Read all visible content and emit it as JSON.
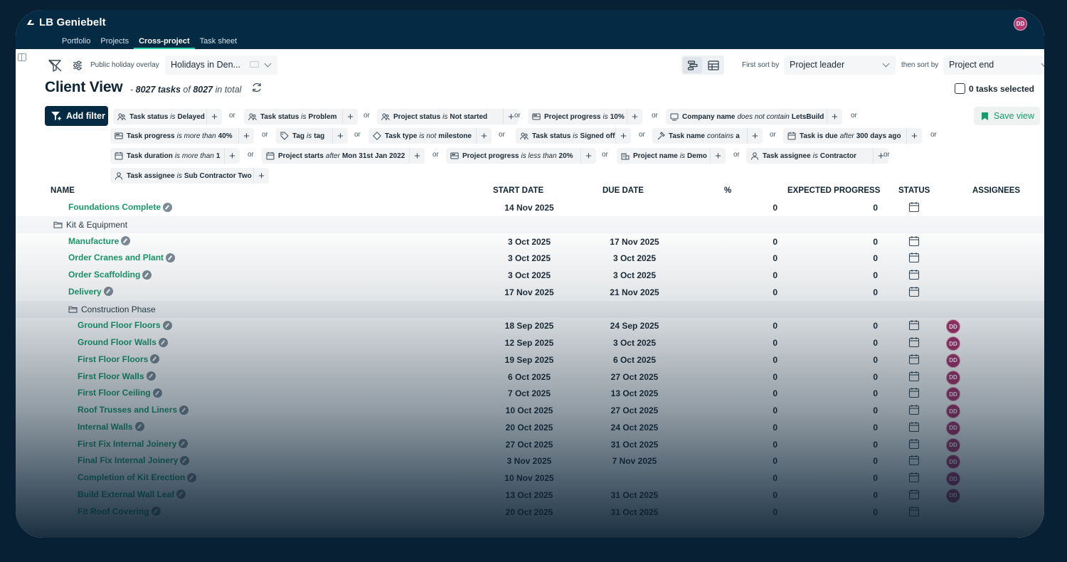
{
  "app": {
    "brand": "LB Geniebelt",
    "avatar_initials": "DD"
  },
  "nav": {
    "tabs": [
      "Portfolio",
      "Projects",
      "Cross-project",
      "Task sheet"
    ],
    "active": "Cross-project"
  },
  "toolbar": {
    "holiday_label": "Public holiday overlay",
    "holiday_value": "Holidays in Den...",
    "first_sort_label": "First sort by",
    "first_sort_value": "Project leader",
    "then_sort_label": "then sort by",
    "then_sort_value": "Project end"
  },
  "header": {
    "title": "Client View",
    "dash": "-",
    "task_count": "8027 tasks",
    "of": "of",
    "total": "8027",
    "in_total": "in total",
    "selected": "0 tasks selected"
  },
  "filters": {
    "add_label": "Add filter",
    "save_label": "Save view",
    "or_label": "or",
    "chips": [
      {
        "field": "Task status",
        "op": "is",
        "val": "Delayed"
      },
      {
        "field": "Task status",
        "op": "is",
        "val": "Problem"
      },
      {
        "field": "Project status",
        "op": "is",
        "val": "Not started"
      },
      {
        "field": "Project progress",
        "op": "is",
        "val": "10%"
      },
      {
        "field": "Company name",
        "op": "does not contain",
        "val": "LetsBuild"
      },
      {
        "field": "Task progress",
        "op": "is more than",
        "val": "40%"
      },
      {
        "field": "Tag",
        "op": "is",
        "val": "tag"
      },
      {
        "field": "Task type",
        "op": "is not",
        "val": "milestone"
      },
      {
        "field": "Task status",
        "op": "is",
        "val": "Signed off"
      },
      {
        "field": "Task name",
        "op": "contains",
        "val": "a"
      },
      {
        "field": "Task is due",
        "op": "after",
        "val": "300 days ago"
      },
      {
        "field": "Task duration",
        "op": "is more than",
        "val": "1"
      },
      {
        "field": "Project starts",
        "op": "after",
        "val": "Mon 31st Jan 2022"
      },
      {
        "field": "Project progress",
        "op": "is less than",
        "val": "20%"
      },
      {
        "field": "Project name",
        "op": "is",
        "val": "Demo"
      },
      {
        "field": "Task assignee",
        "op": "is",
        "val": "Contractor"
      },
      {
        "field": "Task assignee",
        "op": "is",
        "val": "Sub Contractor Two"
      }
    ]
  },
  "table": {
    "columns": {
      "name": "NAME",
      "start": "START DATE",
      "due": "DUE DATE",
      "pct": "%",
      "expected": "EXPECTED PROGRESS",
      "status": "STATUS",
      "assignees": "ASSIGNEES"
    },
    "rows": [
      {
        "type": "task",
        "level": 1,
        "name": "Foundations Complete",
        "start": "14 Nov 2025",
        "due": "",
        "pct": "0",
        "expected": "0",
        "assignee": ""
      },
      {
        "type": "group",
        "level": 0,
        "name": "Kit & Equipment"
      },
      {
        "type": "task",
        "level": 1,
        "name": "Manufacture",
        "start": "3 Oct 2025",
        "due": "17 Nov 2025",
        "pct": "0",
        "expected": "0",
        "assignee": ""
      },
      {
        "type": "task",
        "level": 1,
        "name": "Order Cranes and Plant",
        "start": "3 Oct 2025",
        "due": "3 Oct 2025",
        "pct": "0",
        "expected": "0",
        "assignee": ""
      },
      {
        "type": "task",
        "level": 1,
        "name": "Order Scaffolding",
        "start": "3 Oct 2025",
        "due": "3 Oct 2025",
        "pct": "0",
        "expected": "0",
        "assignee": ""
      },
      {
        "type": "task",
        "level": 1,
        "name": "Delivery",
        "start": "17 Nov 2025",
        "due": "21 Nov 2025",
        "pct": "0",
        "expected": "0",
        "assignee": ""
      },
      {
        "type": "group",
        "level": 1,
        "name": "Construction Phase"
      },
      {
        "type": "task",
        "level": 2,
        "name": "Ground Floor Floors",
        "start": "18 Sep 2025",
        "due": "24 Sep 2025",
        "pct": "0",
        "expected": "0",
        "assignee": "DD"
      },
      {
        "type": "task",
        "level": 2,
        "name": "Ground Floor Walls",
        "start": "12 Sep 2025",
        "due": "3 Oct 2025",
        "pct": "0",
        "expected": "0",
        "assignee": "DD"
      },
      {
        "type": "task",
        "level": 2,
        "name": "First Floor Floors",
        "start": "19 Sep 2025",
        "due": "6 Oct 2025",
        "pct": "0",
        "expected": "0",
        "assignee": "DD"
      },
      {
        "type": "task",
        "level": 2,
        "name": "First Floor Walls",
        "start": "6 Oct 2025",
        "due": "27 Oct 2025",
        "pct": "0",
        "expected": "0",
        "assignee": "DD"
      },
      {
        "type": "task",
        "level": 2,
        "name": "First Floor Ceiling",
        "start": "7 Oct 2025",
        "due": "13 Oct 2025",
        "pct": "0",
        "expected": "0",
        "assignee": "DD"
      },
      {
        "type": "task",
        "level": 2,
        "name": "Roof Trusses and Liners",
        "start": "10 Oct 2025",
        "due": "27 Oct 2025",
        "pct": "0",
        "expected": "0",
        "assignee": "DD"
      },
      {
        "type": "task",
        "level": 2,
        "name": "Internal Walls",
        "start": "20 Oct 2025",
        "due": "24 Oct 2025",
        "pct": "0",
        "expected": "0",
        "assignee": "DD"
      },
      {
        "type": "task",
        "level": 2,
        "name": "First Fix Internal Joinery",
        "start": "27 Oct 2025",
        "due": "31 Oct 2025",
        "pct": "0",
        "expected": "0",
        "assignee": "DD"
      },
      {
        "type": "task",
        "level": 2,
        "name": "Final Fix Internal Joinery",
        "start": "3 Nov 2025",
        "due": "7 Nov 2025",
        "pct": "0",
        "expected": "0",
        "assignee": "DD"
      },
      {
        "type": "task",
        "level": 2,
        "name": "Completion of Kit Erection",
        "start": "10 Nov 2025",
        "due": "",
        "pct": "0",
        "expected": "0",
        "assignee": "DD"
      },
      {
        "type": "task",
        "level": 2,
        "name": "Build External Wall Leaf",
        "start": "13 Oct 2025",
        "due": "31 Oct 2025",
        "pct": "0",
        "expected": "0",
        "assignee": "DD"
      },
      {
        "type": "task",
        "level": 2,
        "name": "Fit Roof Covering",
        "start": "20 Oct 2025",
        "due": "31 Oct 2025",
        "pct": "0",
        "expected": "0",
        "assignee": ""
      }
    ]
  },
  "colors": {
    "navy": "#052a44",
    "green": "#1a9a6a",
    "tab_underline": "#2bd0a8",
    "avatar": "#a8336a"
  }
}
